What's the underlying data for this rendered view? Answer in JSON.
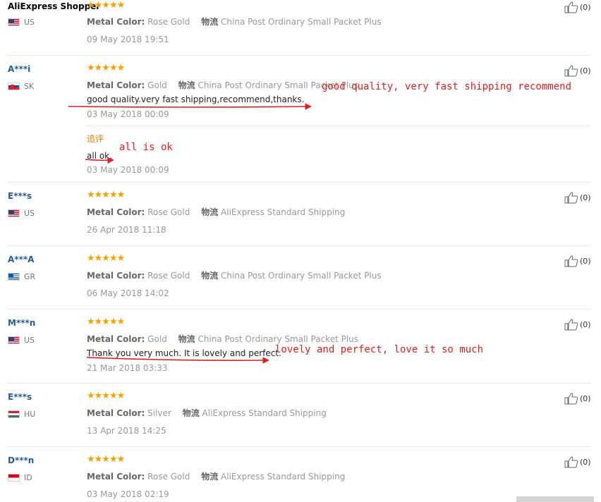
{
  "reviews": [
    {
      "user": "AliExpress Shopper",
      "country": "US",
      "stars": "★★★★★",
      "color_label": "Metal Color:",
      "color": "Rose Gold",
      "ship_label": "物流",
      "ship": "China Post Ordinary Small Packet Plus",
      "date": "09 May 2018 19:51",
      "likes": "(0)"
    },
    {
      "user": "A***i",
      "country": "SK",
      "stars": "★★★★★",
      "color_label": "Metal Color:",
      "color": "Gold",
      "ship_label": "物流",
      "ship": "China Post Ordinary Small Packet Plus",
      "text": "good quality.very fast shipping,recommend,thanks.",
      "date": "03 May 2018 00:09",
      "additional_label": "追评",
      "additional_text": "all ok.",
      "additional_date": "03 May 2018 00:09",
      "likes": "(0)"
    },
    {
      "user": "E***s",
      "country": "US",
      "stars": "★★★★★",
      "color_label": "Metal Color:",
      "color": "Rose Gold",
      "ship_label": "物流",
      "ship": "AliExpress Standard Shipping",
      "date": "26 Apr 2018 11:18",
      "likes": "(0)"
    },
    {
      "user": "A***A",
      "country": "GR",
      "stars": "★★★★★",
      "color_label": "Metal Color:",
      "color": "Rose Gold",
      "ship_label": "物流",
      "ship": "China Post Ordinary Small Packet Plus",
      "date": "06 May 2018 14:02",
      "likes": "(0)"
    },
    {
      "user": "M***n",
      "country": "US",
      "stars": "★★★★★",
      "color_label": "Metal Color:",
      "color": "Gold",
      "ship_label": "物流",
      "ship": "China Post Ordinary Small Packet Plus",
      "text": "Thank you very much. It is lovely and perfect.",
      "date": "21 Mar 2018 03:33",
      "likes": "(0)"
    },
    {
      "user": "E***s",
      "country": "HU",
      "stars": "★★★★★",
      "color_label": "Metal Color:",
      "color": "Silver",
      "ship_label": "物流",
      "ship": "AliExpress Standard Shipping",
      "date": "13 Apr 2018 14:25",
      "likes": "(0)"
    },
    {
      "user": "D***n",
      "country": "ID",
      "stars": "★★★★★",
      "color_label": "Metal Color:",
      "color": "Rose Gold",
      "ship_label": "物流",
      "ship": "AliExpress Standard Shipping",
      "date": "03 May 2018 02:19",
      "likes": "(0)"
    }
  ],
  "annotations": {
    "a1": "good quality, very fast shipping recommend",
    "a2": "all is ok",
    "a3": "lovely and perfect, love it so much"
  },
  "colors": {
    "star": "#f5a100",
    "username": "#245c9a",
    "annotation": "#e02020"
  }
}
